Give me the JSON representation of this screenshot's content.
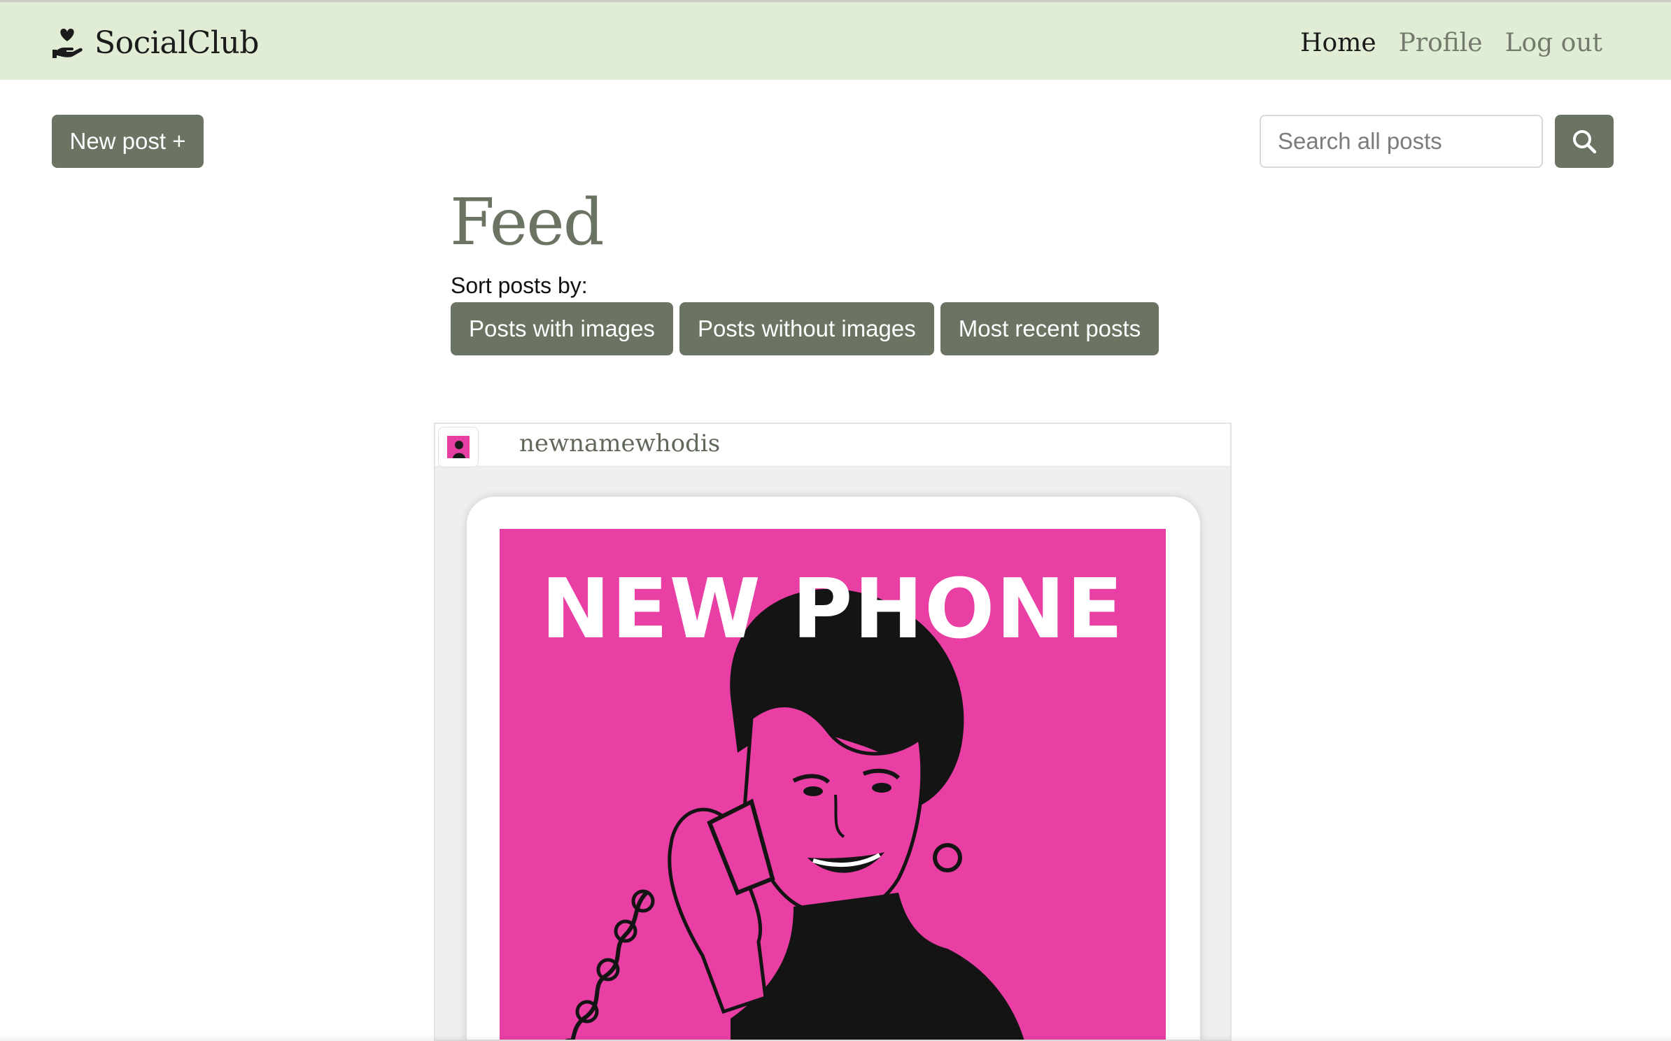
{
  "nav": {
    "brand": "SocialClub",
    "links": {
      "home": "Home",
      "profile": "Profile",
      "logout": "Log out"
    }
  },
  "toolbar": {
    "new_post_label": "New post +",
    "search_placeholder": "Search all posts"
  },
  "feed": {
    "title": "Feed",
    "sort_label": "Sort posts by:",
    "sort_options": [
      "Posts with images",
      "Posts without images",
      "Most recent posts"
    ]
  },
  "posts": [
    {
      "username": "newnamewhodis",
      "image_headline": "NEW  PHONE"
    }
  ],
  "colors": {
    "navbar_bg": "#e1ecd5",
    "button_bg": "#6b7363",
    "accent_pink": "#e93ea3"
  },
  "icons": {
    "brand": "hand-heart-icon",
    "search": "search-icon"
  }
}
